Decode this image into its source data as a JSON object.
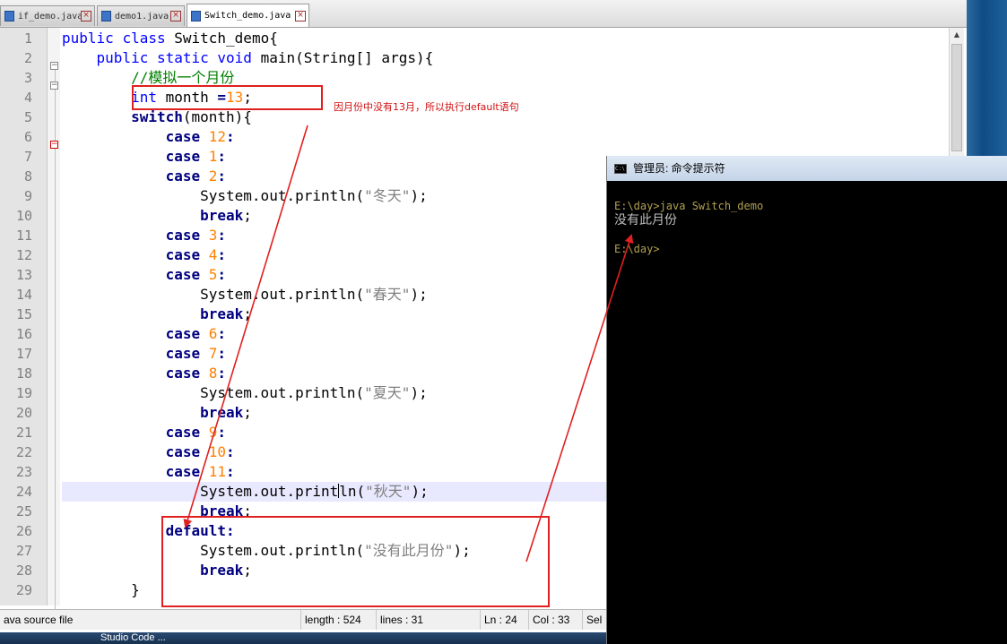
{
  "tabs": [
    {
      "label": "if_demo.java",
      "active": false
    },
    {
      "label": "demo1.java",
      "active": false
    },
    {
      "label": "Switch_demo.java",
      "active": true
    }
  ],
  "code_lines": [
    {
      "no": "1",
      "tokens": [
        [
          "kw",
          "public"
        ],
        [
          "def",
          " "
        ],
        [
          "kw",
          "class"
        ],
        [
          "def",
          " Switch_demo{"
        ]
      ]
    },
    {
      "no": "2",
      "tokens": [
        [
          "def",
          "    "
        ],
        [
          "kw",
          "public"
        ],
        [
          "def",
          " "
        ],
        [
          "kw",
          "static"
        ],
        [
          "def",
          " "
        ],
        [
          "kw",
          "void"
        ],
        [
          "def",
          " main(String[] args){"
        ]
      ]
    },
    {
      "no": "3",
      "tokens": [
        [
          "def",
          "        "
        ],
        [
          "cmt",
          "//模拟一个月份"
        ]
      ]
    },
    {
      "no": "4",
      "tokens": [
        [
          "def",
          "        "
        ],
        [
          "kw",
          "int"
        ],
        [
          "def",
          " month "
        ],
        [
          "op",
          "="
        ],
        [
          "num",
          "13"
        ],
        [
          "def",
          ";"
        ]
      ]
    },
    {
      "no": "5",
      "tokens": [
        [
          "def",
          "        "
        ],
        [
          "kwb",
          "switch"
        ],
        [
          "def",
          "(month){"
        ]
      ]
    },
    {
      "no": "6",
      "tokens": [
        [
          "def",
          "            "
        ],
        [
          "kwb",
          "case"
        ],
        [
          "def",
          " "
        ],
        [
          "num",
          "12"
        ],
        [
          "op",
          ":"
        ]
      ]
    },
    {
      "no": "7",
      "tokens": [
        [
          "def",
          "            "
        ],
        [
          "kwb",
          "case"
        ],
        [
          "def",
          " "
        ],
        [
          "num",
          "1"
        ],
        [
          "op",
          ":"
        ]
      ]
    },
    {
      "no": "8",
      "tokens": [
        [
          "def",
          "            "
        ],
        [
          "kwb",
          "case"
        ],
        [
          "def",
          " "
        ],
        [
          "num",
          "2"
        ],
        [
          "op",
          ":"
        ]
      ]
    },
    {
      "no": "9",
      "tokens": [
        [
          "def",
          "                System.out.println("
        ],
        [
          "str",
          "\"冬天\""
        ],
        [
          "def",
          ");"
        ]
      ]
    },
    {
      "no": "10",
      "tokens": [
        [
          "def",
          "                "
        ],
        [
          "kwb",
          "break"
        ],
        [
          "def",
          ";"
        ]
      ]
    },
    {
      "no": "11",
      "tokens": [
        [
          "def",
          "            "
        ],
        [
          "kwb",
          "case"
        ],
        [
          "def",
          " "
        ],
        [
          "num",
          "3"
        ],
        [
          "op",
          ":"
        ]
      ]
    },
    {
      "no": "12",
      "tokens": [
        [
          "def",
          "            "
        ],
        [
          "kwb",
          "case"
        ],
        [
          "def",
          " "
        ],
        [
          "num",
          "4"
        ],
        [
          "op",
          ":"
        ]
      ]
    },
    {
      "no": "13",
      "tokens": [
        [
          "def",
          "            "
        ],
        [
          "kwb",
          "case"
        ],
        [
          "def",
          " "
        ],
        [
          "num",
          "5"
        ],
        [
          "op",
          ":"
        ]
      ]
    },
    {
      "no": "14",
      "tokens": [
        [
          "def",
          "                System.out.println("
        ],
        [
          "str",
          "\"春天\""
        ],
        [
          "def",
          ");"
        ]
      ]
    },
    {
      "no": "15",
      "tokens": [
        [
          "def",
          "                "
        ],
        [
          "kwb",
          "break"
        ],
        [
          "def",
          ";"
        ]
      ]
    },
    {
      "no": "16",
      "tokens": [
        [
          "def",
          "            "
        ],
        [
          "kwb",
          "case"
        ],
        [
          "def",
          " "
        ],
        [
          "num",
          "6"
        ],
        [
          "op",
          ":"
        ]
      ]
    },
    {
      "no": "17",
      "tokens": [
        [
          "def",
          "            "
        ],
        [
          "kwb",
          "case"
        ],
        [
          "def",
          " "
        ],
        [
          "num",
          "7"
        ],
        [
          "op",
          ":"
        ]
      ]
    },
    {
      "no": "18",
      "tokens": [
        [
          "def",
          "            "
        ],
        [
          "kwb",
          "case"
        ],
        [
          "def",
          " "
        ],
        [
          "num",
          "8"
        ],
        [
          "op",
          ":"
        ]
      ]
    },
    {
      "no": "19",
      "tokens": [
        [
          "def",
          "                System.out.println("
        ],
        [
          "str",
          "\"夏天\""
        ],
        [
          "def",
          ");"
        ]
      ]
    },
    {
      "no": "20",
      "tokens": [
        [
          "def",
          "                "
        ],
        [
          "kwb",
          "break"
        ],
        [
          "def",
          ";"
        ]
      ]
    },
    {
      "no": "21",
      "tokens": [
        [
          "def",
          "            "
        ],
        [
          "kwb",
          "case"
        ],
        [
          "def",
          " "
        ],
        [
          "num",
          "9"
        ],
        [
          "op",
          ":"
        ]
      ]
    },
    {
      "no": "22",
      "tokens": [
        [
          "def",
          "            "
        ],
        [
          "kwb",
          "case"
        ],
        [
          "def",
          " "
        ],
        [
          "num",
          "10"
        ],
        [
          "op",
          ":"
        ]
      ]
    },
    {
      "no": "23",
      "tokens": [
        [
          "def",
          "            "
        ],
        [
          "kwb",
          "case"
        ],
        [
          "def",
          " "
        ],
        [
          "num",
          "11"
        ],
        [
          "op",
          ":"
        ]
      ]
    },
    {
      "no": "24",
      "current": true,
      "tokens": [
        [
          "def",
          "                System.out.print"
        ],
        [
          "cursor",
          ""
        ],
        [
          "def",
          "ln("
        ],
        [
          "str",
          "\"秋天\""
        ],
        [
          "def",
          ");"
        ]
      ]
    },
    {
      "no": "25",
      "tokens": [
        [
          "def",
          "                "
        ],
        [
          "kwb",
          "break"
        ],
        [
          "def",
          ";"
        ]
      ]
    },
    {
      "no": "26",
      "tokens": [
        [
          "def",
          "            "
        ],
        [
          "kwb",
          "default"
        ],
        [
          "op",
          ":"
        ]
      ]
    },
    {
      "no": "27",
      "tokens": [
        [
          "def",
          "                System.out.println("
        ],
        [
          "str",
          "\"没有此月份\""
        ],
        [
          "def",
          ");"
        ]
      ]
    },
    {
      "no": "28",
      "tokens": [
        [
          "def",
          "                "
        ],
        [
          "kwb",
          "break"
        ],
        [
          "def",
          ";"
        ]
      ]
    },
    {
      "no": "29",
      "tokens": [
        [
          "def",
          "        }"
        ]
      ]
    }
  ],
  "annotation": {
    "text": "因月份中没有13月，所以执行default语句",
    "color": "#e02020"
  },
  "statusbar": {
    "file_type": "ava source file",
    "length": "length : 524",
    "lines": "lines : 31",
    "ln": "Ln : 24",
    "col": "Col : 33",
    "sel": "Sel"
  },
  "taskbar": {
    "label": "Studio Code ..."
  },
  "console": {
    "title": "管理员: 命令提示符",
    "icon_text": "C:\\",
    "lines": [
      {
        "text": "E:\\day>java Switch_demo",
        "kind": "prompt"
      },
      {
        "text": "没有此月份",
        "kind": "cn"
      },
      {
        "text": "",
        "kind": "blank"
      },
      {
        "text": "E:\\day>",
        "kind": "prompt"
      }
    ]
  },
  "colors": {
    "keyword": "#0000ff",
    "keyword_bold": "#000080",
    "number": "#ff8000",
    "string": "#808080",
    "comment": "#008000",
    "annotation": "#e02020"
  }
}
